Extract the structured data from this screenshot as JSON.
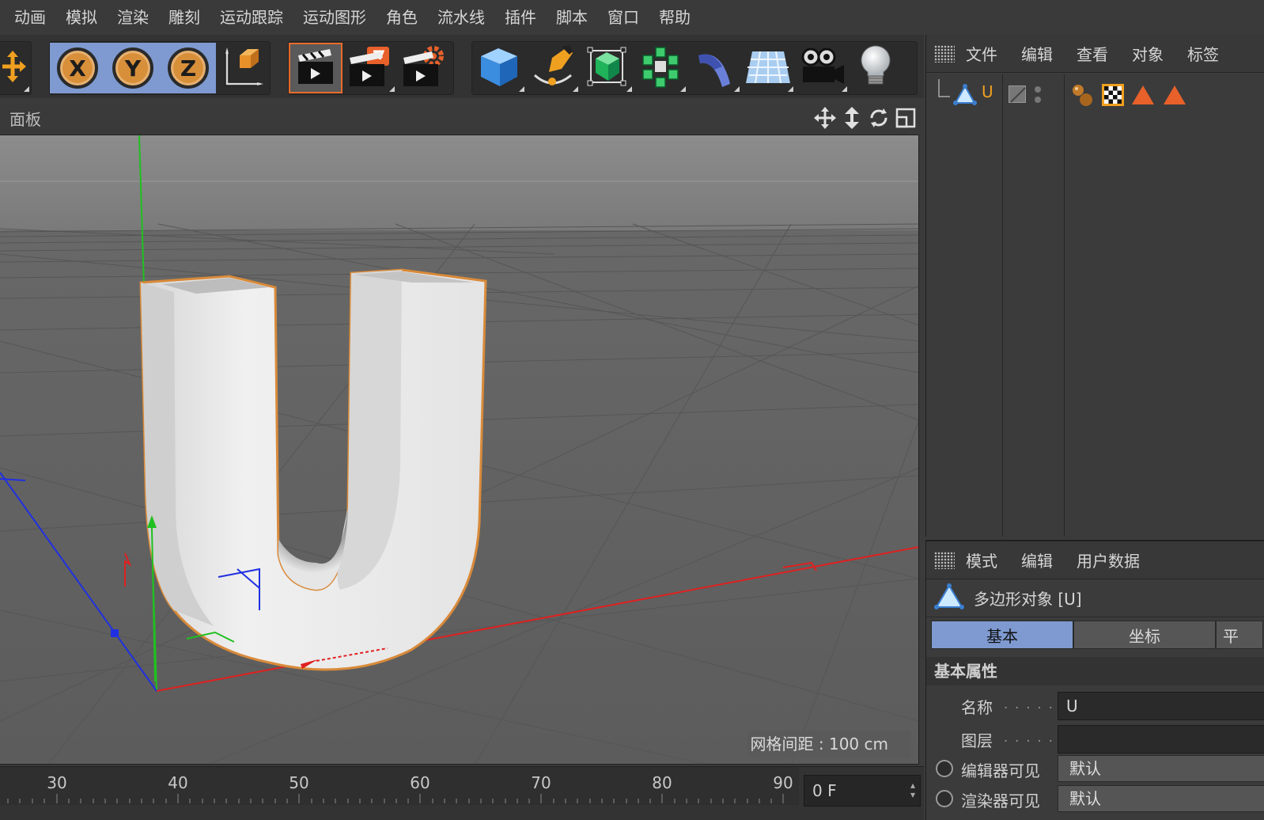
{
  "menu": [
    "动画",
    "模拟",
    "渲染",
    "雕刻",
    "运动跟踪",
    "运动图形",
    "角色",
    "流水线",
    "插件",
    "脚本",
    "窗口",
    "帮助"
  ],
  "toolbar": {
    "move_icon": "move-arrows-icon",
    "axis_x": "X",
    "axis_y": "Y",
    "axis_z": "Z",
    "coord_system_icon": "coordinate-system-icon",
    "render_icons": [
      "render-view-icon",
      "render-to-picture-viewer-icon",
      "render-settings-icon"
    ],
    "object_icons": [
      "cube-icon",
      "pen-spline-icon",
      "subdivision-surface-icon",
      "cloner-icon",
      "deformer-bend-icon",
      "floor-plane-icon",
      "camera-icon",
      "light-bulb-icon"
    ]
  },
  "viewport": {
    "panel_label": "面板",
    "grid_spacing": "网格间距 : 100 cm",
    "header_icons": [
      "pan-view-icon",
      "dolly-view-icon",
      "rotate-view-icon",
      "maximize-view-icon"
    ]
  },
  "timeline": {
    "ticks": [
      "30",
      "40",
      "50",
      "60",
      "70",
      "80",
      "90"
    ],
    "current_frame": "0 F"
  },
  "object_manager": {
    "menu": [
      "文件",
      "编辑",
      "查看",
      "对象",
      "标签"
    ],
    "object_name": "U",
    "tag_icons": [
      "material-tag-icon",
      "checker-texture-tag-icon",
      "phong-tag-icon",
      "phong-tag-icon"
    ]
  },
  "attribute_manager": {
    "menu": [
      "模式",
      "编辑",
      "用户数据"
    ],
    "object_title": "多边形对象 [U]",
    "tabs": [
      "基本",
      "坐标",
      "平"
    ],
    "active_tab": "基本",
    "section": "基本属性",
    "props": {
      "name_label": "名称",
      "name_value": "U",
      "layer_label": "图层",
      "layer_value": "",
      "editor_visible_label": "编辑器可见",
      "editor_visible_value": "默认",
      "renderer_visible_label": "渲染器可见",
      "renderer_visible_value": "默认"
    }
  },
  "colors": {
    "accent_blue": "#7e9ad0",
    "selection_orange": "#d88f3a",
    "x_axis": "#e02020",
    "y_axis": "#20c020",
    "z_axis": "#2030e0"
  }
}
